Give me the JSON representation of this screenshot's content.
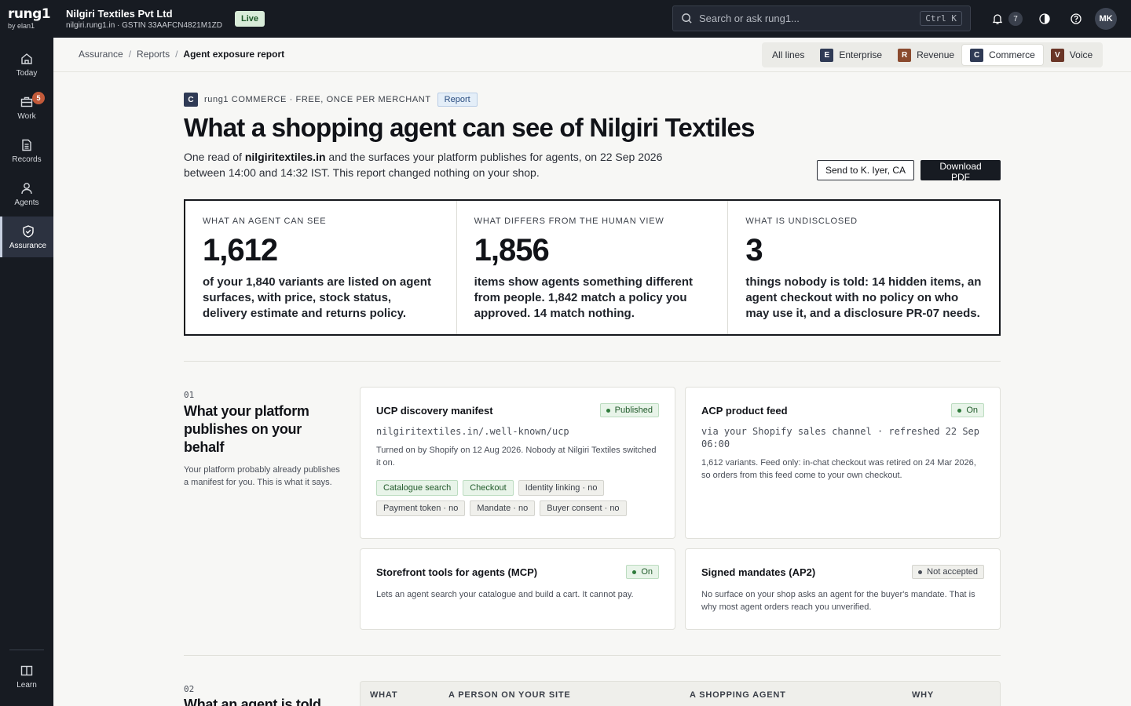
{
  "brand": {
    "logo": "rung1",
    "sub": "by elan1"
  },
  "org": {
    "name": "Nilgiri Textiles Pvt Ltd",
    "meta": "nilgiri.rung1.in · GSTIN 33AAFCN4821M1ZD",
    "status": "Live"
  },
  "search": {
    "placeholder": "Search or ask rung1...",
    "shortcut": "Ctrl K"
  },
  "notifications": {
    "count": "7"
  },
  "user": {
    "initials": "MK"
  },
  "sidebar": {
    "items": [
      {
        "label": "Today",
        "icon": "home-icon"
      },
      {
        "label": "Work",
        "icon": "briefcase-icon",
        "badge": "5"
      },
      {
        "label": "Records",
        "icon": "document-icon"
      },
      {
        "label": "Agents",
        "icon": "user-icon"
      },
      {
        "label": "Assurance",
        "icon": "shield-check-icon",
        "active": true
      }
    ],
    "footer": {
      "label": "Learn",
      "icon": "book-icon"
    }
  },
  "breadcrumb": {
    "items": [
      "Assurance",
      "Reports"
    ],
    "current": "Agent exposure report"
  },
  "lines": {
    "all": "All lines",
    "tabs": [
      {
        "letter": "E",
        "label": "Enterprise",
        "color": "#2f3a55"
      },
      {
        "letter": "R",
        "label": "Revenue",
        "color": "#8a4a2e"
      },
      {
        "letter": "C",
        "label": "Commerce",
        "color": "#2f3a55",
        "active": true
      },
      {
        "letter": "V",
        "label": "Voice",
        "color": "#6a3526"
      }
    ]
  },
  "report": {
    "chip": "C",
    "eyebrow": "rung1 COMMERCE · FREE, ONCE PER MERCHANT",
    "tag": "Report",
    "title": "What a shopping agent can see of Nilgiri Textiles",
    "lede_pre": "One read of ",
    "lede_domain": "nilgiritextiles.in",
    "lede_post": " and the surfaces your platform publishes for agents, on 22 Sep 2026 between 14:00 and 14:32 IST. This report changed nothing on your shop.",
    "send_label": "Send to K. Iyer, CA",
    "download_label": "Download PDF"
  },
  "stats": [
    {
      "label": "WHAT AN AGENT CAN SEE",
      "value": "1,612",
      "desc": "of your 1,840 variants are listed on agent surfaces, with price, stock status, delivery estimate and returns policy."
    },
    {
      "label": "WHAT DIFFERS FROM THE HUMAN VIEW",
      "value": "1,856",
      "desc": "items show agents something different from people. 1,842 match a policy you approved. 14 match nothing."
    },
    {
      "label": "WHAT IS UNDISCLOSED",
      "value": "3",
      "desc": "things nobody is told: 14 hidden items, an agent checkout with no policy on who may use it, and a disclosure PR-07 needs."
    }
  ],
  "section1": {
    "num": "01",
    "title": "What your platform publishes on your behalf",
    "desc": "Your platform probably already publishes a manifest for you. This is what it says.",
    "cards": [
      {
        "title": "UCP discovery manifest",
        "status": "Published",
        "mono": "nilgiritextiles.in/.well-known/ucp",
        "body": "Turned on by Shopify on 12 Aug 2026. Nobody at Nilgiri Textiles switched it on.",
        "pills": [
          {
            "label": "Catalogue search",
            "on": true
          },
          {
            "label": "Checkout",
            "on": true
          },
          {
            "label": "Identity linking · no",
            "on": false
          },
          {
            "label": "Payment token · no",
            "on": false
          },
          {
            "label": "Mandate · no",
            "on": false
          },
          {
            "label": "Buyer consent · no",
            "on": false
          }
        ]
      },
      {
        "title": "ACP product feed",
        "status": "On",
        "mono": "via your Shopify sales channel · refreshed 22 Sep 06:00",
        "body": "1,612 variants. Feed only: in-chat checkout was retired on 24 Mar 2026, so orders from this feed come to your own checkout."
      },
      {
        "title": "Storefront tools for agents (MCP)",
        "status": "On",
        "body": "Lets an agent search your catalogue and build a cart. It cannot pay."
      },
      {
        "title": "Signed mandates (AP2)",
        "status": "Not accepted",
        "body": "No surface on your shop asks an agent for the buyer's mandate. That is why most agent orders reach you unverified."
      }
    ]
  },
  "section2": {
    "num": "02",
    "title": "What an agent is told",
    "columns": [
      "WHAT",
      "A PERSON ON YOUR SITE",
      "A SHOPPING AGENT",
      "WHY"
    ]
  }
}
